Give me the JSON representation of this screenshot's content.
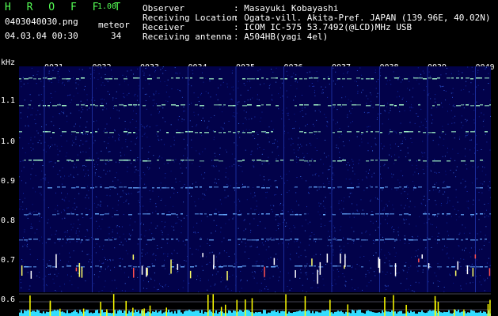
{
  "brand": {
    "name": "H R O F F T",
    "version": "1.00"
  },
  "file": {
    "name": "0403040030.png",
    "datetime": "04.03.04 00:30"
  },
  "meteor": {
    "label": "meteor",
    "count": "34"
  },
  "info": {
    "observer_label": "Observer",
    "observer_value": ": Masayuki Kobayashi",
    "location_label": "Receiving Location",
    "location_value": ": Ogata-vill. Akita-Pref. JAPAN (139.96E, 40.02N)",
    "receiver_label": "Receiver",
    "receiver_value": ": ICOM IC-575 53.7492(@LCD)MHz USB",
    "antenna_label": "Receiving antenna",
    "antenna_value": ": A504HB(yagi 4el)"
  },
  "y_axis": {
    "unit": "kHz",
    "ticks": [
      "1.1",
      "1.0",
      "0.9",
      "0.8",
      "0.7",
      "0.6"
    ]
  },
  "x_axis": {
    "ticks": [
      "0031",
      "0032",
      "0033",
      "0034",
      "0035",
      "0036",
      "0037",
      "0038",
      "0039",
      "0040"
    ]
  },
  "colors": {
    "background": "#000000",
    "spectrogram": "#02024a",
    "signal": "#aaffcc",
    "strip_trace": "#33ddff",
    "strip_peak": "#ffff00"
  }
}
